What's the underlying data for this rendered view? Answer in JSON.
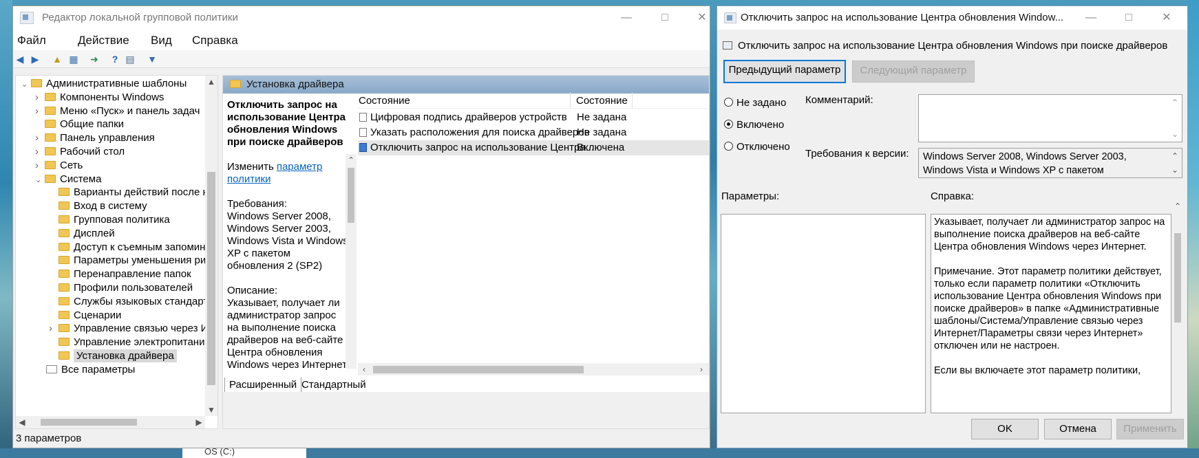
{
  "main_window": {
    "title": "Редактор локальной групповой политики",
    "menu": [
      "Файл",
      "Действие",
      "Вид",
      "Справка"
    ],
    "tree": [
      {
        "label": "Административные шаблоны",
        "level": 0,
        "expanded": true
      },
      {
        "label": "Компоненты Windows",
        "level": 1,
        "expandable": true
      },
      {
        "label": "Меню «Пуск» и панель задач",
        "level": 1,
        "expandable": true
      },
      {
        "label": "Общие папки",
        "level": 1,
        "expandable": false
      },
      {
        "label": "Панель управления",
        "level": 1,
        "expandable": true
      },
      {
        "label": "Рабочий стол",
        "level": 1,
        "expandable": true
      },
      {
        "label": "Сеть",
        "level": 1,
        "expandable": true
      },
      {
        "label": "Система",
        "level": 1,
        "expanded": true
      },
      {
        "label": "Варианты действий после н",
        "level": 2
      },
      {
        "label": "Вход в систему",
        "level": 2
      },
      {
        "label": "Групповая политика",
        "level": 2
      },
      {
        "label": "Дисплей",
        "level": 2
      },
      {
        "label": "Доступ к съемным запомин",
        "level": 2
      },
      {
        "label": "Параметры уменьшения ри",
        "level": 2
      },
      {
        "label": "Перенаправление папок",
        "level": 2
      },
      {
        "label": "Профили пользователей",
        "level": 2
      },
      {
        "label": "Службы языковых стандарт",
        "level": 2
      },
      {
        "label": "Сценарии",
        "level": 2
      },
      {
        "label": "Управление связью через И",
        "level": 2,
        "expandable": true
      },
      {
        "label": "Управление электропитани",
        "level": 2
      },
      {
        "label": "Установка драйвера",
        "level": 2,
        "selected": true
      },
      {
        "label": "Все параметры",
        "level": 1,
        "special": true
      }
    ],
    "right_header": "Установка драйвера",
    "desc": {
      "title": "Отключить запрос на использование Центра обновления Windows при поиске драйверов",
      "edit_prefix": "Изменить ",
      "edit_link": "параметр политики",
      "req_label": "Требования:",
      "req_text": "Windows Server 2008, Windows Server 2003, Windows Vista и Windows XP с пакетом обновления 2 (SP2)",
      "desc_label": "Описание:",
      "desc_text": "Указывает, получает ли администратор запрос на выполнение поиска драйверов на веб-сайте Центра обновления Windows через Интернет."
    },
    "list": {
      "col1": "Состояние",
      "col2": "Состояние",
      "rows": [
        {
          "name": "Цифровая подпись драйверов устройств",
          "state": "Не задана"
        },
        {
          "name": "Указать расположения для поиска драйверов",
          "state": "Не задана"
        },
        {
          "name": "Отключить запрос на использование Центра...",
          "state": "Включена",
          "selected": true
        }
      ]
    },
    "tabs": [
      "Расширенный",
      "Стандартный"
    ],
    "status": "3 параметров"
  },
  "dialog": {
    "title": "Отключить запрос на использование Центра обновления Window...",
    "header": "Отключить запрос на использование Центра обновления Windows при поиске драйверов",
    "prev_btn": "Предыдущий параметр",
    "next_btn": "Следующий параметр",
    "radios": [
      "Не задано",
      "Включено",
      "Отключено"
    ],
    "selected_radio": "Включено",
    "comment_label": "Комментарий:",
    "version_label": "Требования к версии:",
    "version_text": "Windows Server 2008, Windows Server 2003, Windows Vista и Windows XP с пакетом",
    "params_label": "Параметры:",
    "help_label": "Справка:",
    "help_p1": "Указывает, получает ли администратор запрос на выполнение поиска драйверов на веб-сайте Центра обновления Windows через Интернет.",
    "help_p2": "Примечание. Этот параметр политики действует, только если параметр политики «Отключить использование Центра обновления Windows при поиске драйверов» в папке «Административные шаблоны/Система/Управление связью через Интернет/Параметры связи через Интернет» отключен или не настроен.",
    "help_p3": "Если вы включаете этот параметр политики,",
    "ok": "OK",
    "cancel": "Отмена",
    "apply": "Применить"
  },
  "background": {
    "explorer_item": "OS (C:)"
  },
  "colors": {
    "accent": "#0078d7",
    "header_blue": "#9bb5d2",
    "selection": "#cde3f7",
    "link": "#0563c1"
  }
}
